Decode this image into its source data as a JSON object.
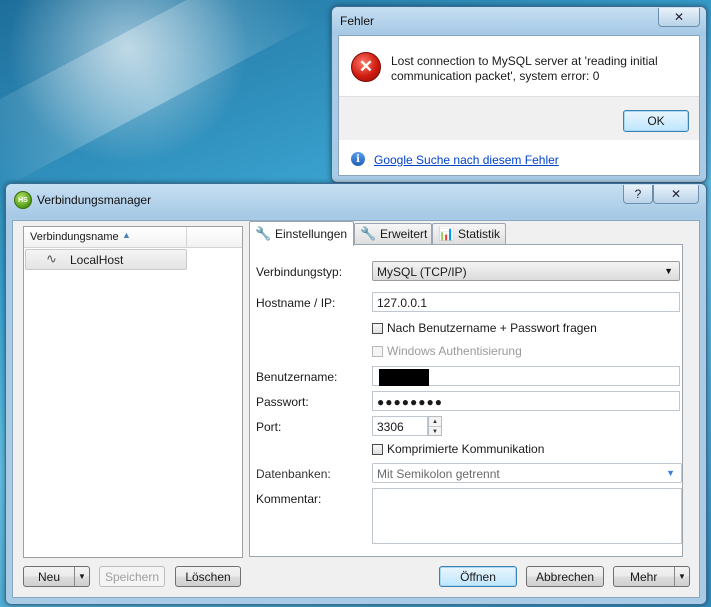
{
  "error_dialog": {
    "title": "Fehler",
    "close_symbol": "✕",
    "icon": "error-x-icon",
    "icon_glyph": "✕",
    "message_line1": "Lost connection to MySQL server at 'reading initial",
    "message_line2": "communication packet', system error: 0",
    "ok_label": "OK",
    "info_icon_glyph": "i",
    "link_text": "Google Suche nach diesem Fehler"
  },
  "main_window": {
    "title": "Verbindungsmanager",
    "app_icon_text": "HS",
    "help_symbol": "?",
    "close_symbol": "✕",
    "list": {
      "column_header": "Verbindungsname",
      "sort_glyph": "▲",
      "items": [
        {
          "label": "LocalHost",
          "icon": "dolphin-icon",
          "glyph": "∿"
        }
      ]
    },
    "tabs": [
      {
        "label": "Einstellungen",
        "icon": "wrench-icon",
        "glyph": "🔧"
      },
      {
        "label": "Erweitert",
        "icon": "wrench-icon",
        "glyph": "🔧"
      },
      {
        "label": "Statistik",
        "icon": "bar-chart-icon",
        "glyph": "📊"
      }
    ],
    "settings": {
      "connection_type_label": "Verbindungstyp:",
      "connection_type_value": "MySQL (TCP/IP)",
      "hostname_label": "Hostname / IP:",
      "hostname_value": "127.0.0.1",
      "ask_credentials_label": "Nach Benutzername + Passwort fragen",
      "windows_auth_label": "Windows Authentisierung",
      "username_label": "Benutzername:",
      "password_label": "Passwort:",
      "password_value": "●●●●●●●●",
      "port_label": "Port:",
      "port_value": "3306",
      "compressed_label": "Komprimierte Kommunikation",
      "databases_label": "Datenbanken:",
      "databases_placeholder": "Mit Semikolon getrennt",
      "comment_label": "Kommentar:"
    },
    "buttons": {
      "new": "Neu",
      "save": "Speichern",
      "delete": "Löschen",
      "open": "Öffnen",
      "cancel": "Abbrechen",
      "more": "Mehr",
      "dropdown_glyph": "▼"
    }
  }
}
